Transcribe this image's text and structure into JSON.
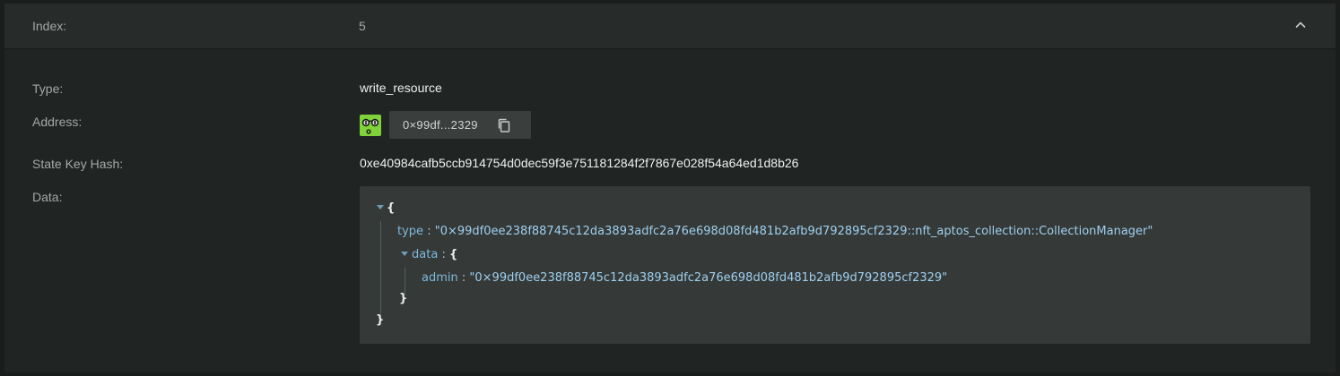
{
  "header": {
    "label": "Index:",
    "value": "5"
  },
  "rows": {
    "type_label": "Type:",
    "type_value": "write_resource",
    "address_label": "Address:",
    "address_short": "0×99df...2329",
    "state_key_hash_label": "State Key Hash:",
    "state_key_hash_value": "0xe40984cafb5ccb914754d0dec59f3e751181284f2f7867e028f54a64ed1d8b26",
    "data_label": "Data:"
  },
  "json": {
    "open_brace": "{",
    "close_brace": "}",
    "type_key": "type",
    "type_value": "\"0×99df0ee238f88745c12da3893adfc2a76e698d08fd481b2afb9d792895cf2329::nft_aptos_collection::CollectionManager\"",
    "data_key": "data",
    "data_open": "{",
    "data_close": "}",
    "admin_key": "admin",
    "admin_value": "\"0×99df0ee238f88745c12da3893adfc2a76e698d08fd481b2afb9d792895cf2329\"",
    "colon": ":"
  },
  "icons": {
    "collapse": "chevron-up-icon",
    "copy": "copy-icon",
    "avatar": "identicon-avatar"
  },
  "colors": {
    "background": "#1a1d1c",
    "panel": "#202524",
    "avatar": "#7fd23a",
    "json_key": "#7fb9dd",
    "json_string": "#9fd0f0"
  }
}
